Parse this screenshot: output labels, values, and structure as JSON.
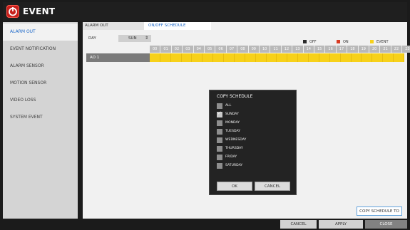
{
  "window": {
    "title": "EVENT"
  },
  "sidebar": {
    "items": [
      {
        "label": "ALARM OUT",
        "active": true
      },
      {
        "label": "EVENT NOTIFICATION",
        "active": false
      },
      {
        "label": "ALARM SENSOR",
        "active": false
      },
      {
        "label": "MOTION SENSOR",
        "active": false
      },
      {
        "label": "VIDEO LOSS",
        "active": false
      },
      {
        "label": "SYSTEM EVENT",
        "active": false
      }
    ]
  },
  "main": {
    "header": {
      "column_a": "ALARM OUT",
      "column_b": "ON/OFF SCHEDULE"
    },
    "day": {
      "label": "DAY",
      "value": "SUN",
      "arrow": "⇕"
    },
    "legend": [
      {
        "label": "OFF",
        "color": "#2b2b2b"
      },
      {
        "label": "ON",
        "color": "#d93b22"
      },
      {
        "label": "EVENT",
        "color": "#f7d119"
      }
    ],
    "hours": [
      "00",
      "01",
      "02",
      "03",
      "04",
      "05",
      "06",
      "07",
      "08",
      "09",
      "10",
      "11",
      "12",
      "13",
      "14",
      "15",
      "16",
      "17",
      "18",
      "19",
      "20",
      "21",
      "22",
      "23"
    ],
    "rows": [
      {
        "name": "AO 1",
        "cell_color": "#f7d119"
      }
    ],
    "copy_schedule_to_label": "COPY SCHEDULE TO"
  },
  "dialog": {
    "title": "COPY SCHEDULE",
    "items": [
      {
        "label": "ALL",
        "checked": false
      },
      {
        "label": "SUNDAY",
        "checked": true
      },
      {
        "label": "MONDAY",
        "checked": false
      },
      {
        "label": "TUESDAY",
        "checked": false
      },
      {
        "label": "WEDNESDAY",
        "checked": false
      },
      {
        "label": "THURSDAY",
        "checked": false
      },
      {
        "label": "FRIDAY",
        "checked": false
      },
      {
        "label": "SATURDAY",
        "checked": false
      }
    ],
    "ok_label": "OK",
    "cancel_label": "CANCEL"
  },
  "footer": {
    "cancel_label": "CANCEL",
    "apply_label": "APPLY",
    "close_label": "CLOSE"
  },
  "icons": {
    "logo": "power-icon"
  }
}
